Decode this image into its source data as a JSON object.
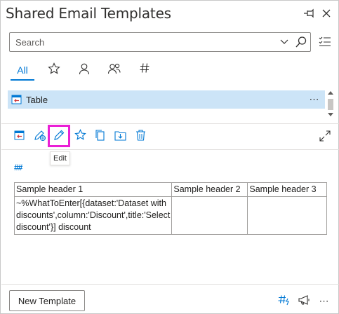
{
  "header": {
    "title": "Shared Email Templates"
  },
  "search": {
    "placeholder": "Search"
  },
  "tabs": [
    {
      "label": "All",
      "icon": "text",
      "active": true
    },
    {
      "label": "",
      "icon": "star-icon"
    },
    {
      "label": "",
      "icon": "person-icon"
    },
    {
      "label": "",
      "icon": "people-icon"
    },
    {
      "label": "",
      "icon": "hashtag-icon"
    }
  ],
  "list": {
    "items": [
      {
        "name": "Table",
        "selected": true
      }
    ],
    "more_glyph": "⋯"
  },
  "toolbar": {
    "tooltip": "Edit",
    "buttons": [
      "insert-icon",
      "share-icon",
      "edit-icon",
      "star-icon",
      "copy-icon",
      "save-to-icon",
      "delete-icon"
    ]
  },
  "preview": {
    "hashtag_marker": "##",
    "table": {
      "headers": [
        "Sample header 1",
        "Sample header 2",
        "Sample header 3"
      ],
      "rows": [
        [
          "~%WhatToEnter[{dataset:'Dataset with discounts',column:'Discount',title:'Select discount'}] discount",
          "",
          ""
        ]
      ]
    }
  },
  "footer": {
    "new_template_label": "New Template",
    "more_glyph": "⋯"
  },
  "colors": {
    "accent": "#0078d4",
    "selection": "#cce4f7",
    "highlight_box": "#ea1fd5"
  }
}
